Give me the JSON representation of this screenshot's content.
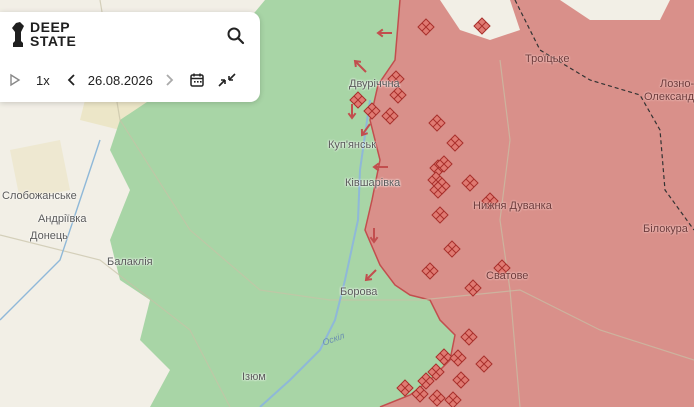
{
  "app": {
    "logo_line1": "DEEP",
    "logo_line2": "STATE"
  },
  "player": {
    "speed": "1x",
    "date": "26.08.2026"
  },
  "colors": {
    "occupied": "#d9908a",
    "liberated": "#a8d5a6",
    "background": "#f2efe6",
    "border_line": "#c24e4e"
  },
  "icons": [
    "logo-icon",
    "search-icon",
    "play-icon",
    "prev-day-icon",
    "next-day-icon",
    "calendar-icon",
    "collapse-icon"
  ],
  "places": [
    {
      "name": "Слобожанське"
    },
    {
      "name": "Андріївка"
    },
    {
      "name": "Донець"
    },
    {
      "name": "Балаклія"
    },
    {
      "name": "Ізюм"
    },
    {
      "name": "Двуріччна"
    },
    {
      "name": "Куп'янськ"
    },
    {
      "name": "Ківшарівка"
    },
    {
      "name": "Борова"
    },
    {
      "name": "Троїцьке"
    },
    {
      "name": "Нижня Дуванка"
    },
    {
      "name": "Сватове"
    },
    {
      "name": "Лозно-"
    },
    {
      "name": "Олександрі"
    },
    {
      "name": "Білокура"
    }
  ],
  "rivers": [
    {
      "name": "Оскіл"
    }
  ]
}
